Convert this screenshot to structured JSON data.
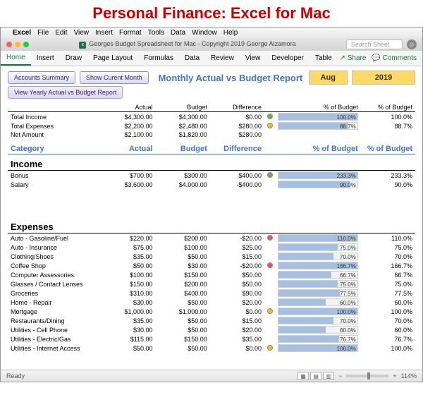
{
  "page_heading": "Personal Finance: Excel for Mac",
  "mac_menu": [
    "Excel",
    "File",
    "Edit",
    "View",
    "Insert",
    "Format",
    "Tools",
    "Data",
    "Window",
    "Help"
  ],
  "doc_title": "Georges Budget Spreadsheet for Mac - Copyright 2019 George Alzamora",
  "search_placeholder": "Search Sheet",
  "ribbon_tabs": [
    "Home",
    "Insert",
    "Draw",
    "Page Layout",
    "Formulas",
    "Data",
    "Review",
    "View",
    "Developer",
    "Table"
  ],
  "share_label": "Share",
  "comments_label": "Comments",
  "buttons": {
    "accounts_summary": "Accounts Summary",
    "show_current_month": "Show Curent Month",
    "view_yearly": "View Yearly Actual vs Budget Report"
  },
  "report_title": "Monthly Actual vs Budget Report",
  "period_month": "Aug",
  "period_year": "2019",
  "summary_headers": [
    "Actual",
    "Budget",
    "Difference",
    "",
    "% of Budget",
    "% of Budget"
  ],
  "summary_rows": [
    {
      "label": "Total Income",
      "actual": "$4,300.00",
      "budget": "$4,300.00",
      "diff": "$0.00",
      "dot": "green",
      "bar": 100.0,
      "bartxt": "100.0%",
      "pct": "100.0%"
    },
    {
      "label": "Total Expenses",
      "actual": "$2,200.00",
      "budget": "$2,480.00",
      "diff": "$280.00",
      "dot": "yellow",
      "bar": 88.7,
      "bartxt": "88.7%",
      "pct": "88.7%"
    },
    {
      "label": "Net Amount",
      "actual": "$2,100.00",
      "budget": "$1,820.00",
      "diff": "$280.00",
      "dot": "",
      "bar": null,
      "bartxt": "",
      "pct": ""
    }
  ],
  "blue_headers": [
    "Category",
    "Actual",
    "Budget",
    "Difference",
    "",
    "% of Budget",
    "% of Budget"
  ],
  "income_label": "Income",
  "income_rows": [
    {
      "label": "Bonus",
      "actual": "$700.00",
      "budget": "$300.00",
      "diff": "$400.00",
      "dot": "green",
      "bar": 100.0,
      "bartxt": "233.3%",
      "pct": "233.3%"
    },
    {
      "label": "Salary",
      "actual": "$3,600.00",
      "budget": "$4,000.00",
      "diff": "-$400.00",
      "dot": "",
      "bar": 90.0,
      "bartxt": "90.0%",
      "pct": "90.0%"
    }
  ],
  "expenses_label": "Expenses",
  "expense_rows": [
    {
      "label": "Auto - Gasoline/Fuel",
      "actual": "$220.00",
      "budget": "$200.00",
      "diff": "-$20.00",
      "dot": "red",
      "bar": 100.0,
      "bartxt": "110.0%",
      "pct": "110.0%"
    },
    {
      "label": "Auto - Insurance",
      "actual": "$75.00",
      "budget": "$100.00",
      "diff": "$25.00",
      "dot": "",
      "bar": 75.0,
      "bartxt": "75.0%",
      "pct": "75.0%"
    },
    {
      "label": "Clothing/Shoes",
      "actual": "$35.00",
      "budget": "$50.00",
      "diff": "$15.00",
      "dot": "",
      "bar": 70.0,
      "bartxt": "70.0%",
      "pct": "70.0%"
    },
    {
      "label": "Coffee Shop",
      "actual": "$50.00",
      "budget": "$30.00",
      "diff": "-$20.00",
      "dot": "red",
      "bar": 100.0,
      "bartxt": "166.7%",
      "pct": "166.7%"
    },
    {
      "label": "Computer Assessories",
      "actual": "$100.00",
      "budget": "$150.00",
      "diff": "$50.00",
      "dot": "",
      "bar": 66.7,
      "bartxt": "66.7%",
      "pct": "66.7%"
    },
    {
      "label": "Glasses / Contact Lenses",
      "actual": "$150.00",
      "budget": "$200.00",
      "diff": "$50.00",
      "dot": "",
      "bar": 75.0,
      "bartxt": "75.0%",
      "pct": "75.0%"
    },
    {
      "label": "Groceries",
      "actual": "$310.00",
      "budget": "$400.00",
      "diff": "$90.00",
      "dot": "",
      "bar": 77.5,
      "bartxt": "77.5%",
      "pct": "77.5%"
    },
    {
      "label": "Home - Repair",
      "actual": "$30.00",
      "budget": "$50.00",
      "diff": "$20.00",
      "dot": "",
      "bar": 60.0,
      "bartxt": "60.0%",
      "pct": "60.0%"
    },
    {
      "label": "Mortgage",
      "actual": "$1,000.00",
      "budget": "$1,000.00",
      "diff": "$0.00",
      "dot": "yellow",
      "bar": 100.0,
      "bartxt": "100.0%",
      "pct": "100.0%"
    },
    {
      "label": "Restaurants/Dining",
      "actual": "$35.00",
      "budget": "$50.00",
      "diff": "$15.00",
      "dot": "",
      "bar": 70.0,
      "bartxt": "70.0%",
      "pct": "70.0%"
    },
    {
      "label": "Utilities - Cell Phone",
      "actual": "$30.00",
      "budget": "$50.00",
      "diff": "$20.00",
      "dot": "",
      "bar": 60.0,
      "bartxt": "60.0%",
      "pct": "60.0%"
    },
    {
      "label": "Utilities - Electric/Gas",
      "actual": "$115.00",
      "budget": "$150.00",
      "diff": "$35.00",
      "dot": "",
      "bar": 76.7,
      "bartxt": "76.7%",
      "pct": "76.7%"
    },
    {
      "label": "Utilities - Internet Access",
      "actual": "$50.00",
      "budget": "$50.00",
      "diff": "$0.00",
      "dot": "yellow",
      "bar": 100.0,
      "bartxt": "100.0%",
      "pct": "100.0%"
    }
  ],
  "status_ready": "Ready",
  "zoom": "114%"
}
